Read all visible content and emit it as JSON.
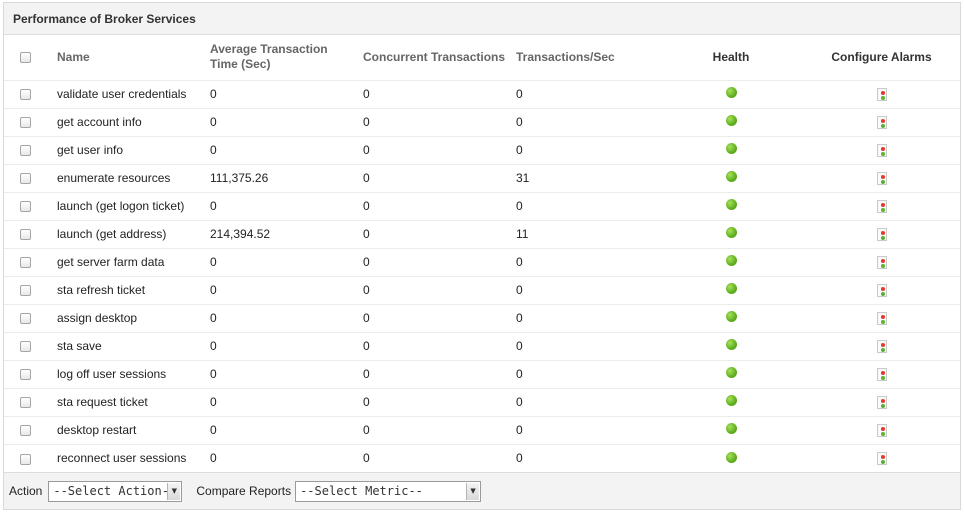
{
  "panel": {
    "title": "Performance of Broker Services"
  },
  "table": {
    "columns": {
      "name": "Name",
      "avg_time": "Average Transaction Time  (Sec)",
      "concurrent": "Concurrent Transactions",
      "tps": "Transactions/Sec",
      "health": "Health",
      "alarms": "Configure Alarms"
    },
    "rows": [
      {
        "name": "validate user credentials",
        "avg": "0",
        "concurrent": "0",
        "tps": "0",
        "health": "green"
      },
      {
        "name": "get account info",
        "avg": "0",
        "concurrent": "0",
        "tps": "0",
        "health": "green"
      },
      {
        "name": "get user info",
        "avg": "0",
        "concurrent": "0",
        "tps": "0",
        "health": "green"
      },
      {
        "name": "enumerate resources",
        "avg": "111,375.26",
        "concurrent": "0",
        "tps": "31",
        "health": "green"
      },
      {
        "name": "launch (get logon ticket)",
        "avg": "0",
        "concurrent": "0",
        "tps": "0",
        "health": "green"
      },
      {
        "name": "launch (get address)",
        "avg": "214,394.52",
        "concurrent": "0",
        "tps": "11",
        "health": "green"
      },
      {
        "name": "get server farm data",
        "avg": "0",
        "concurrent": "0",
        "tps": "0",
        "health": "green"
      },
      {
        "name": "sta refresh ticket",
        "avg": "0",
        "concurrent": "0",
        "tps": "0",
        "health": "green"
      },
      {
        "name": "assign desktop",
        "avg": "0",
        "concurrent": "0",
        "tps": "0",
        "health": "green"
      },
      {
        "name": "sta save",
        "avg": "0",
        "concurrent": "0",
        "tps": "0",
        "health": "green"
      },
      {
        "name": "log off user sessions",
        "avg": "0",
        "concurrent": "0",
        "tps": "0",
        "health": "green"
      },
      {
        "name": "sta request ticket",
        "avg": "0",
        "concurrent": "0",
        "tps": "0",
        "health": "green"
      },
      {
        "name": "desktop restart",
        "avg": "0",
        "concurrent": "0",
        "tps": "0",
        "health": "green"
      },
      {
        "name": "reconnect user sessions",
        "avg": "0",
        "concurrent": "0",
        "tps": "0",
        "health": "green"
      }
    ]
  },
  "footer": {
    "action_label": "Action",
    "action_select": "--Select Action--",
    "compare_label": "Compare Reports",
    "compare_select": "--Select Metric--"
  },
  "colors": {
    "health_ok": "#5fae1f",
    "alarm_red": "#e53a2a",
    "alarm_green": "#5db130"
  },
  "icons": {
    "health": "green-status-dot-icon",
    "alarm": "traffic-light-alarm-icon",
    "select": "dropdown-arrow-icon"
  }
}
